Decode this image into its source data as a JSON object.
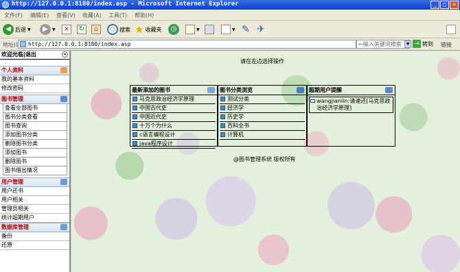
{
  "window": {
    "title": "http://127.0.0.1:8180/index.asp - Microsoft Internet Explorer"
  },
  "menu": [
    "文件(F)",
    "编辑(E)",
    "查看(V)",
    "收藏(A)",
    "工具(T)",
    "帮助(H)"
  ],
  "toolbar": {
    "back": "后退",
    "search": "搜索",
    "favorites": "收藏夹"
  },
  "address": {
    "label": "地址(D)",
    "url": "http://127.0.0.1:8180/index.asp",
    "search_placeholder": "←输入关键词搜索",
    "go": "转到",
    "links": "链接"
  },
  "sidebar": {
    "header": "欢迎光临|退出",
    "collapse": "«",
    "sections": [
      {
        "title": "个人资料",
        "items": [
          "我的基本资料",
          "修改密码"
        ]
      },
      {
        "title": "图书管理",
        "items": [
          "查看全部图书",
          "图书分类查看",
          "图书查询",
          "添加图书分类",
          "删除图书分类",
          "添加图书",
          "删除图书",
          "图书借出情况"
        ]
      },
      {
        "title": "用户管理",
        "items": [
          "用户还书",
          "用户相关",
          "管理员相关",
          "统计超期用户"
        ]
      },
      {
        "title": "数据库管理",
        "items": [
          "备份",
          "还原"
        ]
      }
    ]
  },
  "content": {
    "prompt": "请在左边选择操作",
    "panels": [
      {
        "title": "最新添加的图书",
        "items": [
          "马克思政治经济学原理",
          "中国古代史",
          "中国近代史",
          "十万个为什么",
          "c语言编程设计",
          "java程序设计"
        ]
      },
      {
        "title": "图书分类浏览",
        "items": [
          "测试分类",
          "经济学",
          "历史学",
          "百科全书",
          "计算机"
        ]
      },
      {
        "title": "超期用户提醒",
        "remind": "wangjianlin:请速还[马克思政治经济学原理]"
      }
    ],
    "copyright": "@图书管理系统 版权所有"
  }
}
